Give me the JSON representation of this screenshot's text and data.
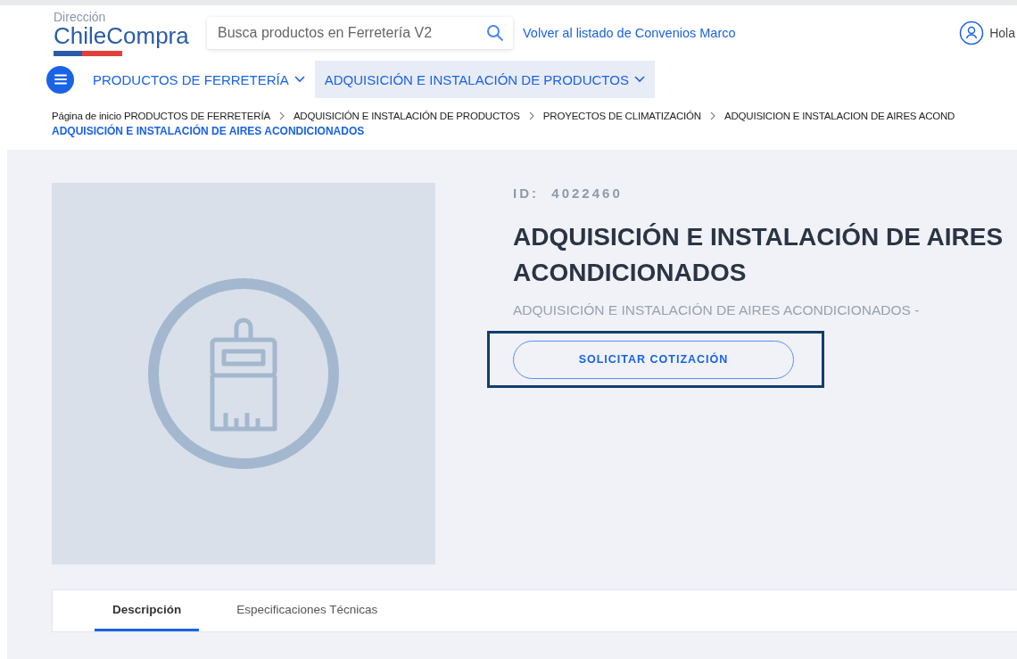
{
  "header": {
    "logo": {
      "top": "Dirección",
      "name": "ChileCompra"
    },
    "search": {
      "placeholder": "Busca productos en Ferretería V2"
    },
    "back_link": "Volver al listado de Convenios Marco",
    "user": "Hola"
  },
  "nav": {
    "items": [
      {
        "label": "PRODUCTOS DE FERRETERÍA",
        "selected": false
      },
      {
        "label": "ADQUISICIÓN E INSTALACIÓN DE PRODUCTOS",
        "selected": true
      }
    ]
  },
  "breadcrumb": {
    "items": [
      "Página de inicio PRODUCTOS DE FERRETERÍA",
      "ADQUISICIÓN E INSTALACIÓN DE PRODUCTOS",
      "PROYECTOS DE CLIMATIZACIÓN",
      "ADQUISICION E INSTALACION DE AIRES ACOND"
    ],
    "current": "ADQUISICIÓN E INSTALACIÓN DE AIRES ACONDICIONADOS"
  },
  "product": {
    "id": "ID:  4022460",
    "title": "ADQUISICIÓN E INSTALACIÓN DE AIRES ACONDICIONADOS",
    "subtitle": "ADQUISICIÓN E INSTALACIÓN DE AIRES ACONDICIONADOS -",
    "button": "SOLICITAR COTIZACIÓN",
    "button_focused": true
  },
  "tabs": [
    {
      "label": "Descripción",
      "selected": true
    },
    {
      "label": "Especificaciones Técnicas",
      "selected": false
    }
  ]
}
